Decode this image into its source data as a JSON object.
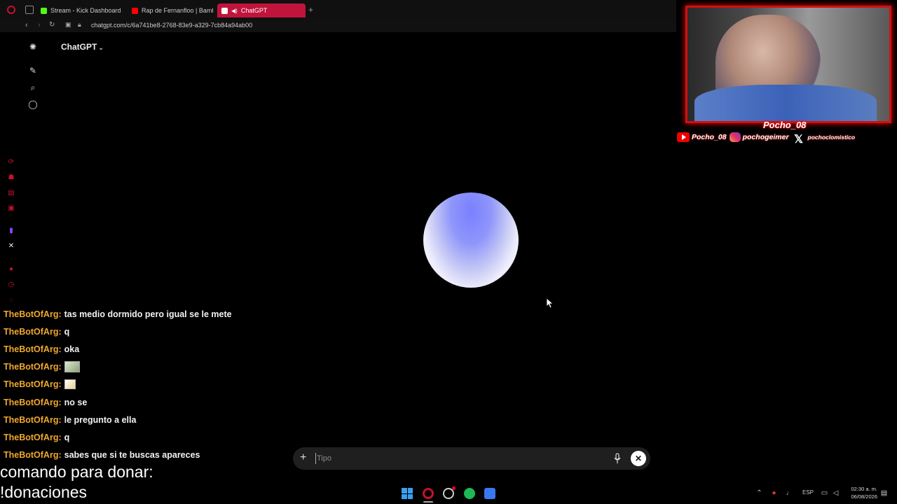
{
  "browser": {
    "tabs": [
      {
        "label": "Stream - Kick Dashboard",
        "favicon_color": "#53fc18",
        "active": false
      },
      {
        "label": "Rap de Fernanfloo | Bamb",
        "favicon_color": "#ff0000",
        "active": false
      },
      {
        "label": "ChatGPT",
        "favicon_color": "#ffffff",
        "active": true
      }
    ],
    "new_tab_symbol": "+",
    "url": "chatgpt.com/c/6a741be8-2768-83e9-a329-7cb84a94ab00"
  },
  "chatgpt": {
    "model_label": "ChatGPT",
    "composer_placeholder": "Tipo"
  },
  "chat": {
    "messages": [
      {
        "user": "TheBotOfArg:",
        "text": "tas medio dormido pero igual se le mete"
      },
      {
        "user": "TheBotOfArg:",
        "text": "q"
      },
      {
        "user": "TheBotOfArg:",
        "text": "oka"
      },
      {
        "user": "TheBotOfArg:",
        "text": "",
        "emote": "emote-image"
      },
      {
        "user": "TheBotOfArg:",
        "text": "",
        "emote": "emote-image"
      },
      {
        "user": "TheBotOfArg:",
        "text": "no se"
      },
      {
        "user": "TheBotOfArg:",
        "text": "le pregunto a ella"
      },
      {
        "user": "TheBotOfArg:",
        "text": "q"
      },
      {
        "user": "TheBotOfArg:",
        "text": "sabes que si te buscas apareces"
      }
    ],
    "username_color": "#f0a830"
  },
  "donation": {
    "line1": "comando para donar:",
    "line2": "!donaciones"
  },
  "streamer": {
    "name": "Pocho_08",
    "youtube": "Pocho_08",
    "instagram": "pochogeimer",
    "x_handle": "pochoclomistico",
    "frame_color": "#d01010"
  },
  "taskbar": {
    "language": "ESP",
    "time": "02:30 a. m.",
    "date": "06/08/2026"
  }
}
